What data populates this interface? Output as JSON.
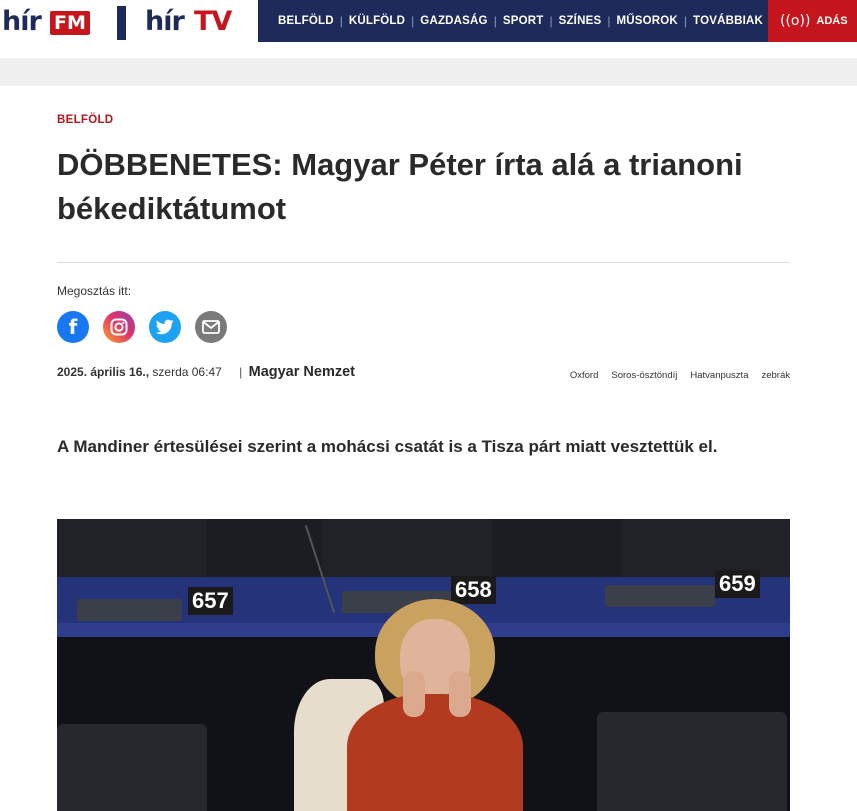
{
  "header": {
    "logo_fm": {
      "hir": "hír",
      "fm": "FM"
    },
    "logo_tv": {
      "hir": "hír",
      "tv": "TV"
    },
    "nav": [
      "BELFÖLD",
      "KÜLFÖLD",
      "GAZDASÁG",
      "SPORT",
      "SZÍNES",
      "MŰSOROK",
      "TOVÁBBIAK"
    ],
    "more_icon": "⋮",
    "live": {
      "label": "ADÁS",
      "icon": "((o))"
    },
    "colors": {
      "navy": "#1d2a5a",
      "red": "#c4161c"
    }
  },
  "article": {
    "category": "BELFÖLD",
    "title": "DÖBBENETES: Magyar Péter írta alá a trianoni békediktátumot",
    "share_label": "Megosztás itt:",
    "share_icons": [
      "facebook-icon",
      "instagram-icon",
      "twitter-icon",
      "email-icon"
    ],
    "date": "2025. április 16.,",
    "weekday_time": "szerda 06:47",
    "author_sep": "|",
    "author": "Magyar Nemzet",
    "tags": [
      "Oxford",
      "Soros-ösztöndíj",
      "Hatvanpuszta",
      "zebrák"
    ],
    "lead": "A Mandiner értesülései szerint a mohácsi csatát is a Tisza párt miatt vesztettük el."
  },
  "photo": {
    "seat_numbers": [
      "657",
      "658",
      "659"
    ]
  }
}
